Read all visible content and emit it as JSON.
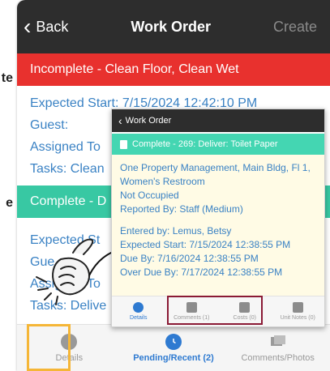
{
  "cutoff": {
    "left_top": "te",
    "left_mid": "e"
  },
  "header": {
    "back_label": "Back",
    "title": "Work Order",
    "create_label": "Create"
  },
  "orders": [
    {
      "status": "Incomplete - Clean Floor, Clean Wet",
      "lines": [
        "Expected Start: 7/15/2024 12:42:10 PM",
        "Guest:",
        "Assigned To",
        "Tasks: Clean"
      ]
    },
    {
      "status": "Complete - D",
      "lines": [
        "Expected St",
        "Gue",
        "Assigned To",
        "Tasks: Delive"
      ]
    }
  ],
  "tabs": [
    {
      "label": "Details",
      "icon": "info-icon"
    },
    {
      "label": "Pending/Recent (2)",
      "icon": "clock-icon"
    },
    {
      "label": "Comments/Photos",
      "icon": "photos-icon"
    }
  ],
  "popup": {
    "title": "Work Order",
    "status": "Complete - 269: Deliver: Toilet Paper",
    "location": "One Property Management, Main Bldg, Fl 1, Women's Restroom",
    "occupancy": "Not Occupied",
    "reported": "Reported By: Staff  (Medium)",
    "entered": "Entered by: Lemus, Betsy",
    "expected": "Expected Start: 7/15/2024 12:38:55 PM",
    "due": "Due By: 7/16/2024 12:38:55 PM",
    "overdue": "Over Due By: 7/17/2024 12:38:55 PM",
    "tabs": [
      "Details",
      "Comments (1)",
      "Costs (0)",
      "Unit Notes (0)"
    ]
  },
  "colors": {
    "header": "#2d2d2d",
    "incomplete": "#e8312e",
    "complete": "#38c8a3",
    "link": "#3a82c4",
    "highlight_yellow": "#f5b637",
    "highlight_maroon": "#8a1a35"
  }
}
